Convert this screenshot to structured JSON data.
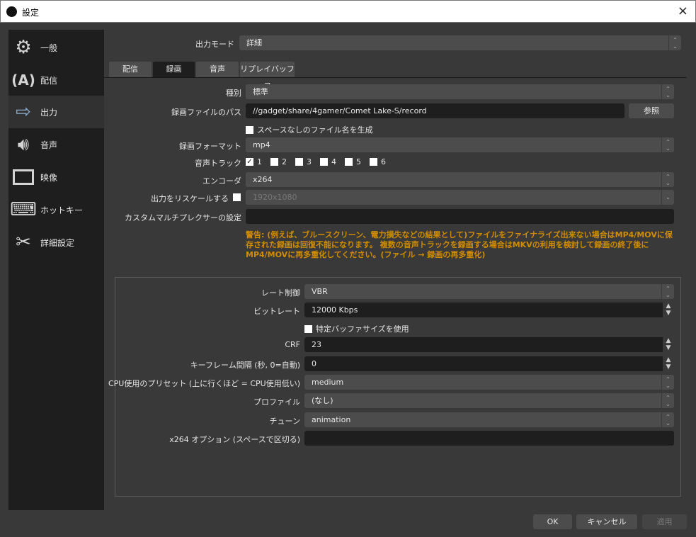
{
  "window": {
    "title": "設定",
    "close_icon": "×"
  },
  "sidebar": {
    "items": [
      {
        "label": "一般",
        "icon": "gear-icon"
      },
      {
        "label": "配信",
        "icon": "broadcast-icon"
      },
      {
        "label": "出力",
        "icon": "output-icon",
        "selected": true
      },
      {
        "label": "音声",
        "icon": "speaker-icon"
      },
      {
        "label": "映像",
        "icon": "monitor-icon"
      },
      {
        "label": "ホットキー",
        "icon": "keyboard-icon"
      },
      {
        "label": "詳細設定",
        "icon": "tools-icon"
      }
    ]
  },
  "output_mode": {
    "label": "出力モード",
    "value": "詳細"
  },
  "tabs": [
    "配信",
    "録画",
    "音声",
    "リプレイバッファ"
  ],
  "recording": {
    "type": {
      "label": "種別",
      "value": "標準"
    },
    "path": {
      "label": "録画ファイルのパス",
      "value": "//gadget/share/4gamer/Comet Lake-S/record",
      "browse": "参照"
    },
    "nospace": {
      "label": "スペースなしのファイル名を生成"
    },
    "format": {
      "label": "録画フォーマット",
      "value": "mp4"
    },
    "tracks": {
      "label": "音声トラック",
      "items": [
        "1",
        "2",
        "3",
        "4",
        "5",
        "6"
      ]
    },
    "encoder": {
      "label": "エンコーダ",
      "value": "x264"
    },
    "rescale": {
      "label": "出力をリスケールする",
      "value": "1920x1080"
    },
    "muxer": {
      "label": "カスタムマルチプレクサーの設定",
      "value": ""
    },
    "warning": "警告: (例えば、ブルースクリーン、電力損失などの結果として)ファイルをファイナライズ出来ない場合はMP4/MOVに保存された録画は回復不能になります。 複数の音声トラックを録画する場合はMKVの利用を検討して録画の終了後にMP4/MOVに再多重化してください。(ファイル → 録画の再多重化)"
  },
  "encoder_settings": {
    "rate_control": {
      "label": "レート制御",
      "value": "VBR"
    },
    "bitrate": {
      "label": "ビットレート",
      "value": "12000 Kbps"
    },
    "buffer": {
      "label": "特定バッファサイズを使用"
    },
    "crf": {
      "label": "CRF",
      "value": "23"
    },
    "keyint": {
      "label": "キーフレーム間隔 (秒, 0=自動)",
      "value": "0"
    },
    "preset": {
      "label": "CPU使用のプリセット (上に行くほど = CPU使用低い)",
      "value": "medium"
    },
    "profile": {
      "label": "プロファイル",
      "value": "(なし)"
    },
    "tune": {
      "label": "チューン",
      "value": "animation"
    },
    "x264opts": {
      "label": "x264 オプション (スペースで区切る)",
      "value": ""
    }
  },
  "buttons": {
    "ok": "OK",
    "cancel": "キャンセル",
    "apply": "適用"
  }
}
